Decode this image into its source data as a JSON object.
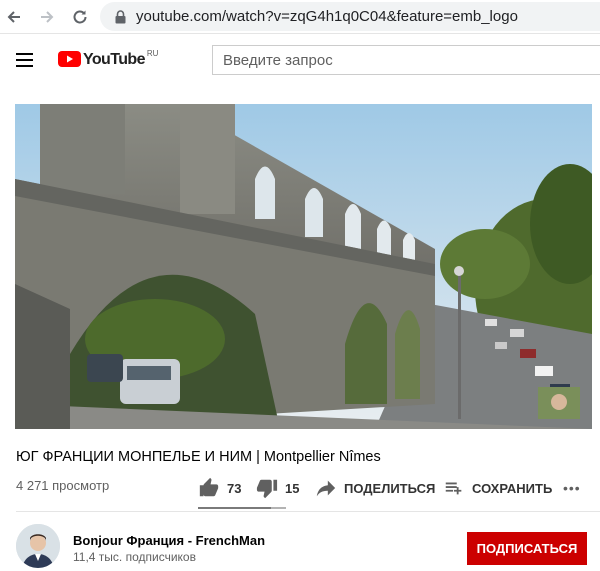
{
  "browser": {
    "url": "youtube.com/watch?v=zqG4h1q0C04&feature=emb_logo"
  },
  "header": {
    "logo_text": "YouTube",
    "logo_country": "RU",
    "search_placeholder": "Введите запрос"
  },
  "video": {
    "title": "ЮГ ФРАНЦИИ МОНПЕЛЬЕ И НИМ | Montpellier Nîmes",
    "views": "4 271 просмотр",
    "likes": "73",
    "dislikes": "15",
    "like_ratio": 0.83,
    "share_label": "ПОДЕЛИТЬСЯ",
    "save_label": "СОХРАНИТЬ",
    "more_label": "•••"
  },
  "channel": {
    "name": "Bonjour Франция - FrenchMan",
    "subscribers": "11,4 тыс. подписчиков",
    "subscribe_label": "ПОДПИСАТЬСЯ"
  },
  "colors": {
    "brand_red": "#cc0000",
    "text_secondary": "#606060"
  }
}
